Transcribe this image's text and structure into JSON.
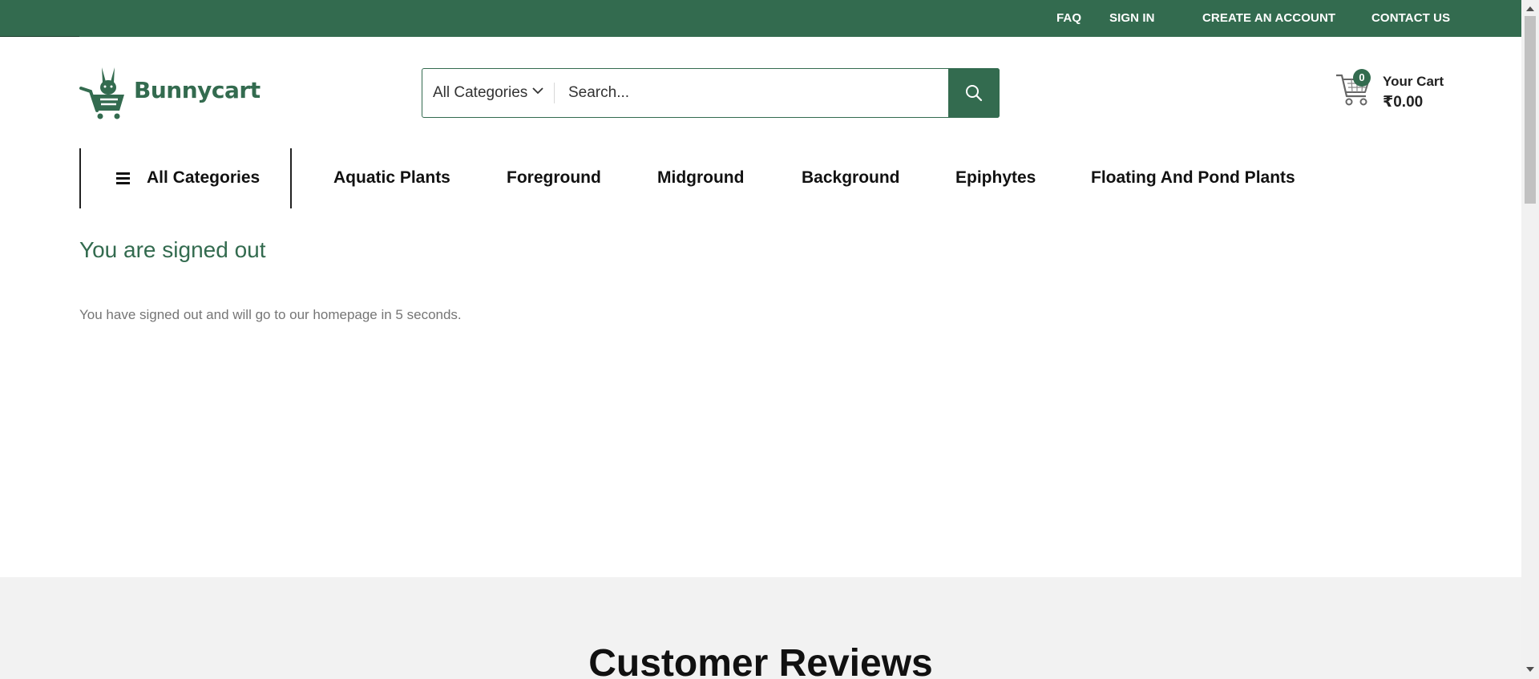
{
  "topbar": {
    "links": {
      "faq": "FAQ",
      "sign_in": "SIGN IN",
      "create_account": "CREATE AN ACCOUNT",
      "contact_us": "CONTACT US"
    }
  },
  "header": {
    "logo_text": "Bunnycart",
    "search": {
      "category": "All Categories",
      "placeholder": "Search..."
    },
    "cart": {
      "count": "0",
      "label": "Your Cart",
      "total": "₹0.00"
    }
  },
  "nav": {
    "all_categories": "All Categories",
    "items": [
      "Aquatic Plants",
      "Foreground",
      "Midground",
      "Background",
      "Epiphytes",
      "Floating And Pond Plants"
    ]
  },
  "main": {
    "title": "You are signed out",
    "message": "You have signed out and will go to our homepage in 5 seconds."
  },
  "reviews": {
    "title": "Customer Reviews"
  },
  "colors": {
    "brand_green": "#336b4f",
    "review_bg": "#f2f2f2",
    "message_gray": "#757575"
  },
  "icons": {
    "menu": "hamburger-icon",
    "search": "search-icon",
    "cart": "shopping-cart-icon",
    "dropdown": "chevron-down-icon",
    "logo": "bunny-cart-logo"
  }
}
